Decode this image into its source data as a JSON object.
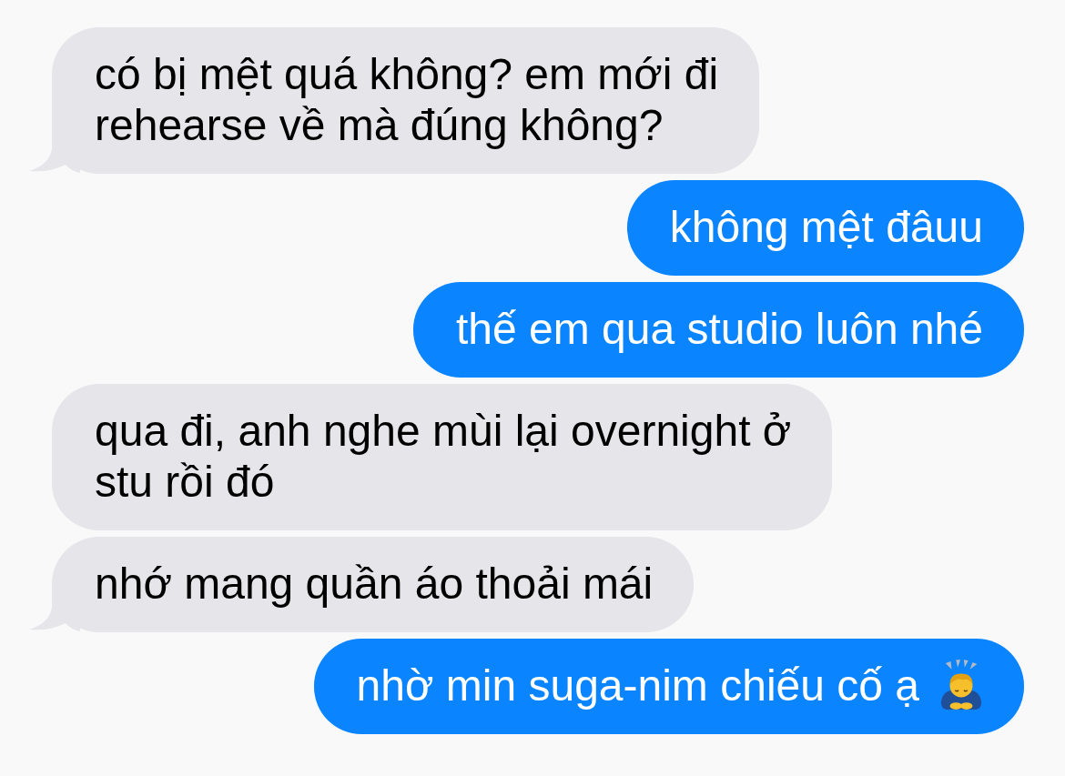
{
  "messages": [
    {
      "kind": "received",
      "text": "có bị mệt quá không? em mới đi\nrehearse về mà đúng không?",
      "tail": true,
      "has_emoji": false
    },
    {
      "kind": "sent",
      "text": "không mệt đâuu",
      "tail": false,
      "has_emoji": false
    },
    {
      "kind": "sent",
      "text": "thế em qua studio luôn nhé",
      "tail": false,
      "has_emoji": false
    },
    {
      "kind": "received",
      "text": "qua đi, anh nghe mùi lại overnight ở\nstu rồi đó",
      "tail": false,
      "has_emoji": false
    },
    {
      "kind": "received",
      "text": "nhớ mang quần áo thoải mái",
      "tail": true,
      "has_emoji": false
    },
    {
      "kind": "sent",
      "text": "nhờ min suga-nim chiếu cố ạ",
      "tail": false,
      "has_emoji": true
    }
  ]
}
